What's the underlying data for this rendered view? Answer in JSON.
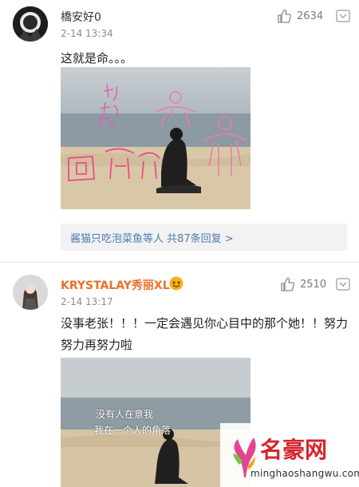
{
  "comments": [
    {
      "username": "橋安好0",
      "time": "2-14 13:34",
      "likes": "2634",
      "text": "这就是命。。。",
      "reply_summary": "酱猫只吃泡菜鱼等人 共87条回复 >"
    },
    {
      "username": "KRYSTALAY秀丽XL",
      "time": "2-14 13:17",
      "likes": "2510",
      "text": "没事老张！！！一定会遇见你心目中的那个她！！努力努力再努力啦",
      "photo_overlay": [
        "没有人在意我",
        "我在一个人的角落"
      ]
    }
  ],
  "site_logo": {
    "title": "名豪网",
    "url": "minghaoshangwu.com"
  },
  "colors": {
    "username_orange": "#e8702a",
    "link_blue": "#4f7cae",
    "logo_red": "#d6232a"
  },
  "icons": [
    "thumbs-up-icon",
    "chevron-down-icon",
    "vip-badge-icon"
  ]
}
